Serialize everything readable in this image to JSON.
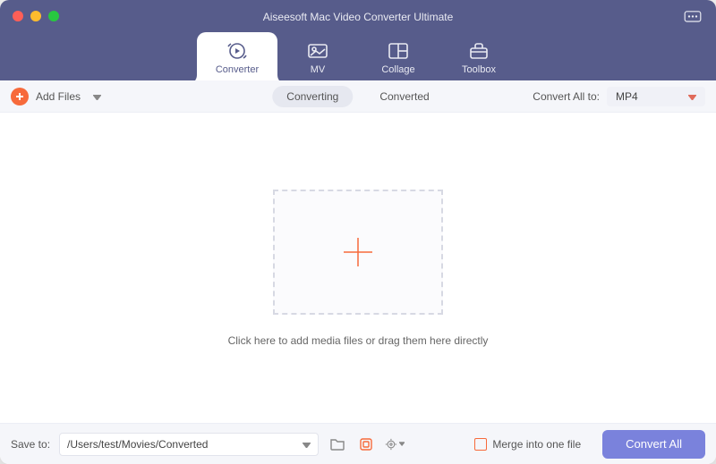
{
  "window": {
    "title": "Aiseesoft Mac Video Converter Ultimate"
  },
  "tabs": {
    "converter": "Converter",
    "mv": "MV",
    "collage": "Collage",
    "toolbox": "Toolbox"
  },
  "toolbar": {
    "add_files": "Add Files",
    "seg_converting": "Converting",
    "seg_converted": "Converted",
    "convert_all_to_label": "Convert All to:",
    "format_selected": "MP4"
  },
  "canvas": {
    "hint": "Click here to add media files or drag them here directly"
  },
  "footer": {
    "save_to_label": "Save to:",
    "save_path": "/Users/test/Movies/Converted",
    "merge_label": "Merge into one file",
    "convert_all_btn": "Convert All"
  }
}
